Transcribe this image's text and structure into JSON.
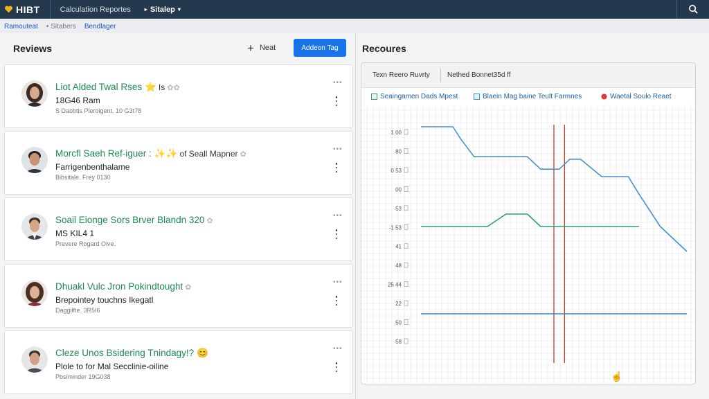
{
  "topbar": {
    "app_title": "HIBT",
    "link": "Calculation Reportes",
    "menu_label": "Sitalep",
    "accent": "#f2b313",
    "background": "#24384e"
  },
  "breadcrumb": [
    "Ramouteat",
    "Sitabers",
    "Bendlager"
  ],
  "reviews": {
    "title": "Reviews",
    "next_label": "Neat",
    "primary_label": "Addeon Tag",
    "cards": [
      {
        "title": "Liot Alded Twal Rses",
        "emoji": "⭐",
        "suffix": "Is",
        "faint": "✿✿",
        "subtitle": "18G46 Ram",
        "meta": "S Daobtis Pleroigent. 10 G3t78"
      },
      {
        "title": "Morcfl Saeh Ref-iguer :",
        "emoji": "✨✨",
        "suffix": "of Seall Mapner",
        "faint": "✿",
        "subtitle": "Farrigenbenthalame",
        "meta": "Bibsitale. Frey 0130"
      },
      {
        "title": "Soail Eionge Sors Brver Blandn 320",
        "emoji": "",
        "suffix": "",
        "faint": "✿",
        "subtitle": "MS KIL4 1",
        "meta": "Prevere Rogard Oive."
      },
      {
        "title": "Dhuakl Vulc Jron Pokindtought",
        "emoji": "",
        "suffix": "",
        "faint": "✿",
        "subtitle": "Brepointey touchns Ikegatl",
        "meta": "Daggilfte. 3R5I6"
      },
      {
        "title": "Cleze Unos Bsidering Tnindagy!?",
        "emoji": "😊",
        "suffix": "",
        "faint": "",
        "subtitle": "Plole to for Mal Secclinie-oiline",
        "meta": "Pbsiminder 19G038"
      }
    ]
  },
  "resources": {
    "title": "Recoures",
    "toolbar_item1": "Texn Reero Ruvrty",
    "toolbar_item2": "Nethed Bonnet35d ff",
    "legend": [
      {
        "label": "Seaingamen Dads Mpest",
        "color": "#2e8b57"
      },
      {
        "label": "Blaein Mag baine Teult Farmnes",
        "color": "#1e88c8"
      },
      {
        "label": "Waetal Soulo Reaet",
        "color": "#d83a3a"
      }
    ]
  },
  "chart_data": {
    "type": "line",
    "ytick_labels": [
      "1 00",
      "80",
      "0 53",
      "00",
      "53",
      "-1 53",
      "41",
      "48",
      "25 44",
      "22",
      "50",
      "58"
    ],
    "series": [
      {
        "color": "#4a8fd0",
        "values": [
          [
            0,
            0.95
          ],
          [
            0.12,
            0.95
          ],
          [
            0.15,
            0.9
          ],
          [
            0.2,
            0.83
          ],
          [
            0.25,
            0.83
          ],
          [
            0.4,
            0.83
          ],
          [
            0.45,
            0.78
          ],
          [
            0.52,
            0.78
          ],
          [
            0.56,
            0.82
          ],
          [
            0.6,
            0.82
          ],
          [
            0.68,
            0.75
          ],
          [
            0.78,
            0.75
          ],
          [
            0.82,
            0.68
          ],
          [
            0.9,
            0.55
          ],
          [
            1,
            0.45
          ]
        ]
      },
      {
        "color": "#2e9e72",
        "values": [
          [
            0,
            0.55
          ],
          [
            0.25,
            0.55
          ],
          [
            0.32,
            0.6
          ],
          [
            0.4,
            0.6
          ],
          [
            0.45,
            0.55
          ],
          [
            0.82,
            0.55
          ]
        ]
      },
      {
        "color": "#3a7fc0",
        "values": [
          [
            0,
            0.2
          ],
          [
            1,
            0.2
          ]
        ]
      }
    ],
    "vertical_markers": [
      {
        "color": "#c0392b",
        "at": 0.5
      },
      {
        "color": "#c0392b",
        "at": 0.54
      }
    ],
    "grid": true
  }
}
